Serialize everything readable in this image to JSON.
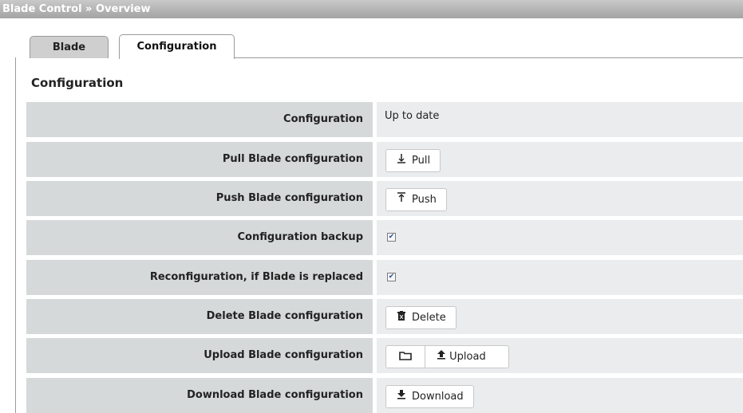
{
  "header": {
    "breadcrumb": "Blade Control » Overview"
  },
  "tabs": [
    {
      "label": "Blade",
      "active": false
    },
    {
      "label": "Configuration",
      "active": true
    }
  ],
  "section": {
    "title": "Configuration"
  },
  "rows": {
    "status": {
      "label": "Configuration",
      "value": "Up to date"
    },
    "pull": {
      "label": "Pull Blade configuration",
      "button": "Pull",
      "icon": "pull-icon"
    },
    "push": {
      "label": "Push Blade configuration",
      "button": "Push",
      "icon": "push-icon"
    },
    "backup": {
      "label": "Configuration backup",
      "checked": true
    },
    "reconfig": {
      "label": "Reconfiguration, if Blade is replaced",
      "checked": true
    },
    "delete": {
      "label": "Delete Blade configuration",
      "button": "Delete",
      "icon": "trash-icon"
    },
    "upload": {
      "label": "Upload Blade configuration",
      "button": "Upload",
      "icon": "upload-icon",
      "browse_icon": "folder-icon"
    },
    "download": {
      "label": "Download Blade configuration",
      "button": "Download",
      "icon": "download-icon"
    }
  }
}
